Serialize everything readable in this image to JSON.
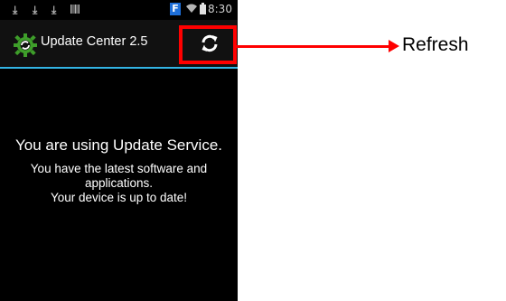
{
  "status_bar": {
    "time": "8:30",
    "icons": [
      "download-icon",
      "download-icon",
      "download-icon",
      "barcode-icon",
      "f-badge-icon",
      "wifi-icon",
      "battery-icon"
    ],
    "f_badge": "F"
  },
  "action_bar": {
    "title": "Update Center 2.5",
    "app_icon": "gear-sync-icon",
    "refresh_icon": "refresh-icon",
    "accent_color": "#33b5e5"
  },
  "content": {
    "headline": "You are using Update Service.",
    "message_line1": "You have the latest software and applications.",
    "message_line2": "Your device is up to date!"
  },
  "annotation": {
    "label": "Refresh",
    "color": "#ff0000"
  }
}
